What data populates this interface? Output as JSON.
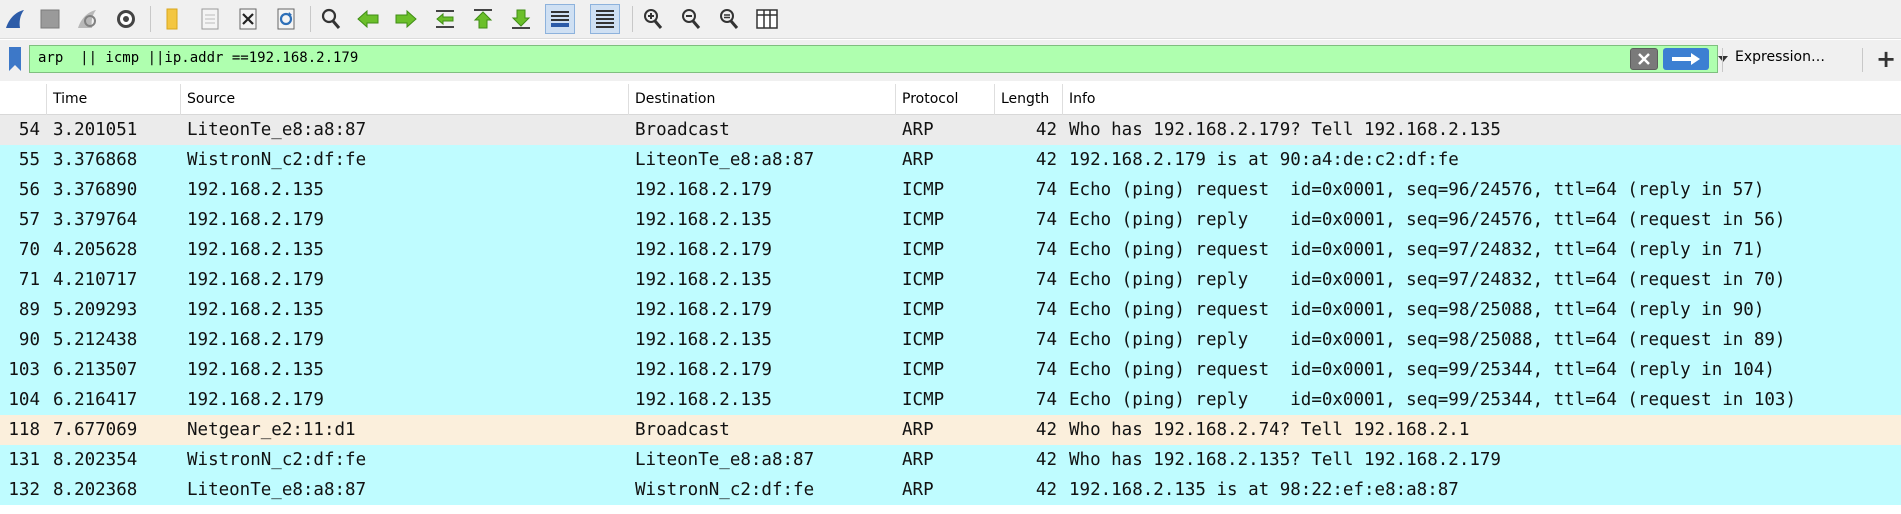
{
  "toolbar": {
    "buttons": [
      {
        "name": "start-capture-button",
        "icon": "shark-fin-icon"
      },
      {
        "name": "stop-capture-button",
        "icon": "stop-icon"
      },
      {
        "name": "restart-capture-button",
        "icon": "restart-fin-icon"
      },
      {
        "name": "capture-options-button",
        "icon": "gear-icon"
      },
      {
        "name": "open-file-button",
        "icon": "folder-icon"
      },
      {
        "name": "save-file-button",
        "icon": "document-icon"
      },
      {
        "name": "close-file-button",
        "icon": "close-file-icon"
      },
      {
        "name": "reload-file-button",
        "icon": "reload-icon"
      },
      {
        "name": "find-packet-button",
        "icon": "magnifier-icon"
      },
      {
        "name": "go-back-button",
        "icon": "arrow-left-icon"
      },
      {
        "name": "go-forward-button",
        "icon": "arrow-right-icon"
      },
      {
        "name": "go-to-packet-button",
        "icon": "goto-icon"
      },
      {
        "name": "go-first-packet-button",
        "icon": "arrow-up-icon"
      },
      {
        "name": "go-last-packet-button",
        "icon": "arrow-down-icon"
      },
      {
        "name": "auto-scroll-button",
        "icon": "autoscroll-icon"
      },
      {
        "name": "colorize-button",
        "icon": "colorize-lines-icon"
      },
      {
        "name": "zoom-in-button",
        "icon": "zoom-in-icon"
      },
      {
        "name": "zoom-out-button",
        "icon": "zoom-out-icon"
      },
      {
        "name": "normal-size-button",
        "icon": "zoom-reset-icon"
      },
      {
        "name": "resize-columns-button",
        "icon": "resize-columns-icon"
      }
    ]
  },
  "filter": {
    "value": "arp  || icmp ||ip.addr ==192.168.2.179",
    "expression_label": "Expression…",
    "add_label": "+"
  },
  "columns": [
    "",
    "Time",
    "Source",
    "Destination",
    "Protocol",
    "Length",
    "Info"
  ],
  "colors": {
    "arp_broadcast_row": "#ebebeb",
    "icmp_arp_row": "#bffcff",
    "netgear_arp_row": "#fbefdc",
    "filter_valid": "#afffaf",
    "apply_blue": "#3c7fd2"
  },
  "packets": [
    {
      "no": "54",
      "time": "3.201051",
      "source": "LiteonTe_e8:a8:87",
      "destination": "Broadcast",
      "protocol": "ARP",
      "length": "42",
      "info": "Who has 192.168.2.179? Tell 192.168.2.135",
      "color": "#ebebeb"
    },
    {
      "no": "55",
      "time": "3.376868",
      "source": "WistronN_c2:df:fe",
      "destination": "LiteonTe_e8:a8:87",
      "protocol": "ARP",
      "length": "42",
      "info": "192.168.2.179 is at 90:a4:de:c2:df:fe",
      "color": "#bffcff"
    },
    {
      "no": "56",
      "time": "3.376890",
      "source": "192.168.2.135",
      "destination": "192.168.2.179",
      "protocol": "ICMP",
      "length": "74",
      "info": "Echo (ping) request  id=0x0001, seq=96/24576, ttl=64 (reply in 57)",
      "color": "#bffcff"
    },
    {
      "no": "57",
      "time": "3.379764",
      "source": "192.168.2.179",
      "destination": "192.168.2.135",
      "protocol": "ICMP",
      "length": "74",
      "info": "Echo (ping) reply    id=0x0001, seq=96/24576, ttl=64 (request in 56)",
      "color": "#bffcff"
    },
    {
      "no": "70",
      "time": "4.205628",
      "source": "192.168.2.135",
      "destination": "192.168.2.179",
      "protocol": "ICMP",
      "length": "74",
      "info": "Echo (ping) request  id=0x0001, seq=97/24832, ttl=64 (reply in 71)",
      "color": "#bffcff"
    },
    {
      "no": "71",
      "time": "4.210717",
      "source": "192.168.2.179",
      "destination": "192.168.2.135",
      "protocol": "ICMP",
      "length": "74",
      "info": "Echo (ping) reply    id=0x0001, seq=97/24832, ttl=64 (request in 70)",
      "color": "#bffcff"
    },
    {
      "no": "89",
      "time": "5.209293",
      "source": "192.168.2.135",
      "destination": "192.168.2.179",
      "protocol": "ICMP",
      "length": "74",
      "info": "Echo (ping) request  id=0x0001, seq=98/25088, ttl=64 (reply in 90)",
      "color": "#bffcff"
    },
    {
      "no": "90",
      "time": "5.212438",
      "source": "192.168.2.179",
      "destination": "192.168.2.135",
      "protocol": "ICMP",
      "length": "74",
      "info": "Echo (ping) reply    id=0x0001, seq=98/25088, ttl=64 (request in 89)",
      "color": "#bffcff"
    },
    {
      "no": "103",
      "time": "6.213507",
      "source": "192.168.2.135",
      "destination": "192.168.2.179",
      "protocol": "ICMP",
      "length": "74",
      "info": "Echo (ping) request  id=0x0001, seq=99/25344, ttl=64 (reply in 104)",
      "color": "#bffcff"
    },
    {
      "no": "104",
      "time": "6.216417",
      "source": "192.168.2.179",
      "destination": "192.168.2.135",
      "protocol": "ICMP",
      "length": "74",
      "info": "Echo (ping) reply    id=0x0001, seq=99/25344, ttl=64 (request in 103)",
      "color": "#bffcff"
    },
    {
      "no": "118",
      "time": "7.677069",
      "source": "Netgear_e2:11:d1",
      "destination": "Broadcast",
      "protocol": "ARP",
      "length": "42",
      "info": "Who has 192.168.2.74? Tell 192.168.2.1",
      "color": "#fbefdc"
    },
    {
      "no": "131",
      "time": "8.202354",
      "source": "WistronN_c2:df:fe",
      "destination": "LiteonTe_e8:a8:87",
      "protocol": "ARP",
      "length": "42",
      "info": "Who has 192.168.2.135? Tell 192.168.2.179",
      "color": "#bffcff"
    },
    {
      "no": "132",
      "time": "8.202368",
      "source": "LiteonTe_e8:a8:87",
      "destination": "WistronN_c2:df:fe",
      "protocol": "ARP",
      "length": "42",
      "info": "192.168.2.135 is at 98:22:ef:e8:a8:87",
      "color": "#bffcff"
    }
  ]
}
